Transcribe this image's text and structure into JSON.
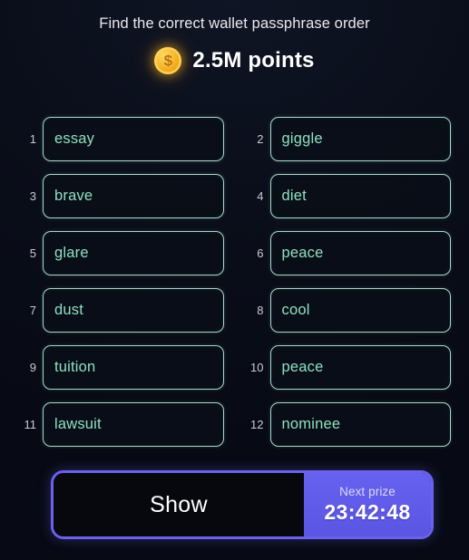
{
  "header": {
    "title": "Find the correct wallet passphrase order",
    "coin_icon": "gold-dollar-coin-icon",
    "coin_symbol": "$",
    "prize_amount": "2.5M points"
  },
  "passphrase": {
    "words": [
      {
        "index": "1",
        "word": "essay"
      },
      {
        "index": "2",
        "word": "giggle"
      },
      {
        "index": "3",
        "word": "brave"
      },
      {
        "index": "4",
        "word": "diet"
      },
      {
        "index": "5",
        "word": "glare"
      },
      {
        "index": "6",
        "word": "peace"
      },
      {
        "index": "7",
        "word": "dust"
      },
      {
        "index": "8",
        "word": "cool"
      },
      {
        "index": "9",
        "word": "tuition"
      },
      {
        "index": "10",
        "word": "peace"
      },
      {
        "index": "11",
        "word": "lawsuit"
      },
      {
        "index": "12",
        "word": "nominee"
      }
    ]
  },
  "action": {
    "show_label": "Show",
    "next_prize_label": "Next prize",
    "timer": "23:42:48"
  },
  "colors": {
    "background": "#0a0e1a",
    "tile_border": "#a9d8c9",
    "word_text": "#8fe0c1",
    "accent_purple": "#6a61ef",
    "coin_gold": "#f5b426",
    "text_primary": "#ffffff"
  }
}
